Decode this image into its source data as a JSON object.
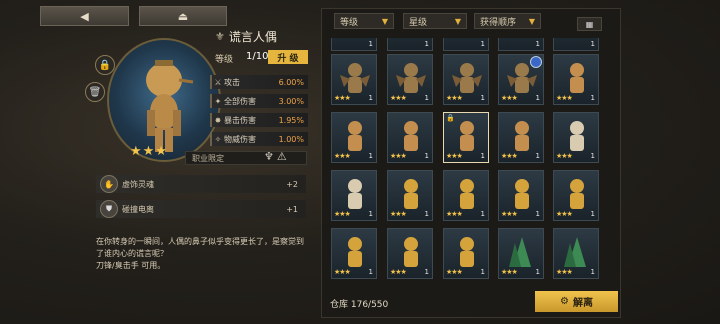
{
  "top": {
    "back_icon": "◀",
    "home_icon": "⏏"
  },
  "hero": {
    "name": "谎言人偶",
    "level_label": "等级",
    "level_value": "1/10",
    "upgrade_label": "升 级",
    "stars": "★★★",
    "stats": [
      {
        "icon": "sword-icon",
        "glyph": "⚔",
        "label": "攻击",
        "value": "6.00%"
      },
      {
        "icon": "all-damage-icon",
        "glyph": "✦",
        "label": "全部伤害",
        "value": "3.00%"
      },
      {
        "icon": "crit-icon",
        "glyph": "✸",
        "label": "暴击伤害",
        "value": "1.95%"
      },
      {
        "icon": "physical-icon",
        "glyph": "✧",
        "label": "物威伤害",
        "value": "1.00%"
      }
    ],
    "job_label": "职业限定",
    "skills": [
      {
        "icon": "skill-soul-icon",
        "name": "虚饰灵魂",
        "level": "+2"
      },
      {
        "icon": "skill-shield-icon",
        "name": "碰撞电离",
        "level": "+1"
      }
    ],
    "description": "在你转身的一瞬间，人偶的鼻子似乎变得更长了，是察觉到了谁内心的谎言呢？\n刀锋/臭击手 可用。"
  },
  "filters": {
    "sort1": "等级",
    "sort2": "星级",
    "sort3": "获得顺序"
  },
  "grid": {
    "top_partial_level": "1"
  },
  "inventory": {
    "storage_text": "仓库 176/550",
    "dismantle_label": "解离"
  },
  "colors": {
    "accent": "#e5b53d",
    "stat_value": "#f0a448"
  }
}
